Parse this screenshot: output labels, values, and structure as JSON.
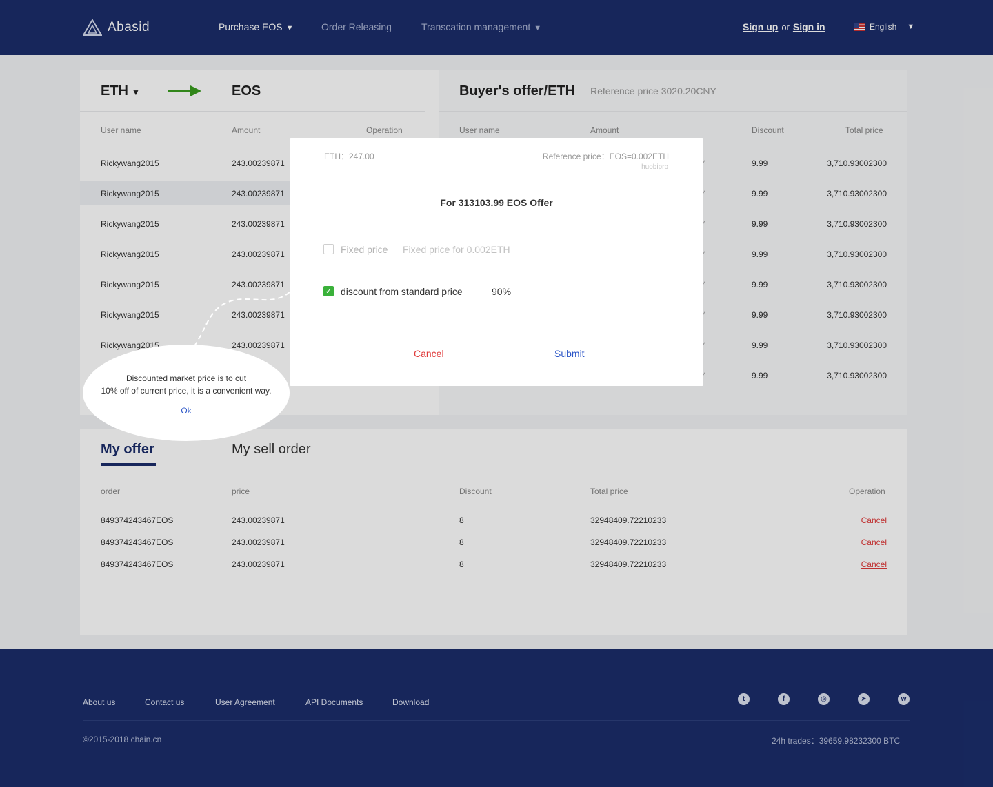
{
  "header": {
    "brand": "Abasid",
    "nav": [
      {
        "label": "Purchase EOS",
        "caret": true
      },
      {
        "label": "Order Releasing",
        "caret": false
      },
      {
        "label": "Transcation management",
        "caret": true
      }
    ],
    "sign_up": "Sign up",
    "or": "or",
    "sign_in": "Sign in",
    "language": "English",
    "caret": "▼"
  },
  "trade": {
    "from": "ETH",
    "to": "EOS",
    "columns": [
      "User name",
      "Amount",
      "Operation"
    ],
    "rows": [
      {
        "user": "Rickywang2015",
        "amount": "243.00239871"
      },
      {
        "user": "Rickywang2015",
        "amount": "243.00239871"
      },
      {
        "user": "Rickywang2015",
        "amount": "243.00239871"
      },
      {
        "user": "Rickywang2015",
        "amount": "243.00239871"
      },
      {
        "user": "Rickywang2015",
        "amount": "243.00239871"
      },
      {
        "user": "Rickywang2015",
        "amount": "243.00239871"
      },
      {
        "user": "Rickywang2015",
        "amount": "243.00239871"
      }
    ]
  },
  "buyers": {
    "title": "Buyer's offer/ETH",
    "reference": "Reference price 3020.20CNY",
    "columns": [
      "User name",
      "Amount",
      "Discount",
      "Total price"
    ],
    "rows": [
      {
        "amount_tail": "Y",
        "discount": "9.99",
        "total": "3,710.93002300"
      },
      {
        "amount_tail": "Y",
        "discount": "9.99",
        "total": "3,710.93002300"
      },
      {
        "amount_tail": "Y",
        "discount": "9.99",
        "total": "3,710.93002300"
      },
      {
        "amount_tail": "Y",
        "discount": "9.99",
        "total": "3,710.93002300"
      },
      {
        "amount_tail": "Y",
        "discount": "9.99",
        "total": "3,710.93002300"
      },
      {
        "amount_tail": "Y",
        "discount": "9.99",
        "total": "3,710.93002300"
      },
      {
        "amount_tail": "Y",
        "discount": "9.99",
        "total": "3,710.93002300"
      },
      {
        "amount_tail": "Y",
        "discount": "9.99",
        "total": "3,710.93002300"
      }
    ]
  },
  "orders": {
    "tabs": [
      "My offer",
      "My sell order"
    ],
    "columns": [
      "order",
      "price",
      "Discount",
      "Total price",
      "Operation"
    ],
    "rows": [
      {
        "order": "849374243467EOS",
        "price": "243.00239871",
        "discount": "8",
        "total": "32948409.72210233",
        "action": "Cancel"
      },
      {
        "order": "849374243467EOS",
        "price": "243.00239871",
        "discount": "8",
        "total": "32948409.72210233",
        "action": "Cancel"
      },
      {
        "order": "849374243467EOS",
        "price": "243.00239871",
        "discount": "8",
        "total": "32948409.72210233",
        "action": "Cancel"
      }
    ]
  },
  "modal": {
    "balance": "ETH：247.00",
    "reference": "Reference price：EOS=0.002ETH",
    "source": "huobipro",
    "title": "For 313103.99 EOS Offer",
    "fixed_label": "Fixed price",
    "fixed_placeholder": "Fixed price   for 0.002ETH",
    "fixed_checked": false,
    "discount_label": "discount from standard price",
    "discount_value": "90%",
    "discount_checked": true,
    "cancel": "Cancel",
    "submit": "Submit"
  },
  "tooltip": {
    "line1": "Discounted market price is to cut",
    "line2": "10% off of current price, it is a convenient way.",
    "ok": "Ok"
  },
  "footer": {
    "links": [
      "About us",
      "Contact us",
      "User Agreement",
      "API Documents",
      "Download"
    ],
    "copyright": "©2015-2018  chain.cn",
    "trades": "24h trades：39659.98232300   BTC",
    "social_icons": [
      "twitter-icon",
      "facebook-icon",
      "instagram-icon",
      "telegram-icon",
      "weibo-icon"
    ]
  },
  "colors": {
    "brand_navy": "#1b2d6b",
    "accent_green": "#3ab13a",
    "danger_red": "#e03a3a",
    "link_blue": "#2d57c7"
  }
}
